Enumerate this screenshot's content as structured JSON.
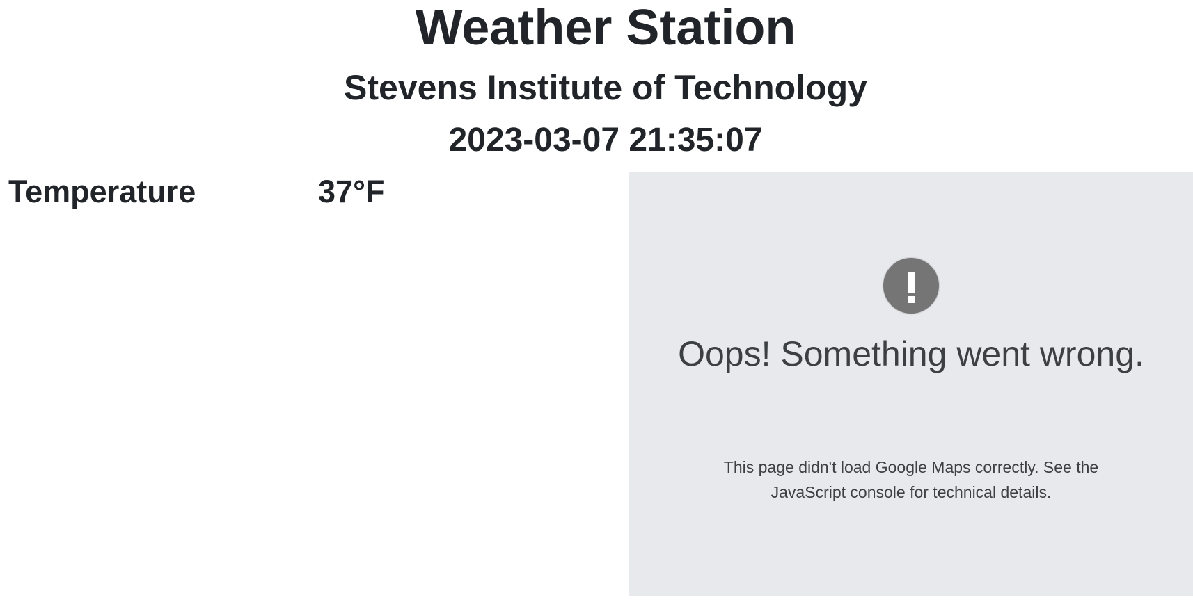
{
  "header": {
    "title": "Weather Station",
    "location": "Stevens Institute of Technology",
    "timestamp": "2023-03-07 21:35:07"
  },
  "readings": [
    {
      "label": "Temperature",
      "value": "37°F"
    }
  ],
  "map": {
    "icon": "exclamation-icon",
    "error_title": "Oops! Something went wrong.",
    "error_message": "This page didn't load Google Maps correctly. See the JavaScript console for technical details.",
    "background_color": "#e8e9ed",
    "icon_color": "#757575"
  }
}
